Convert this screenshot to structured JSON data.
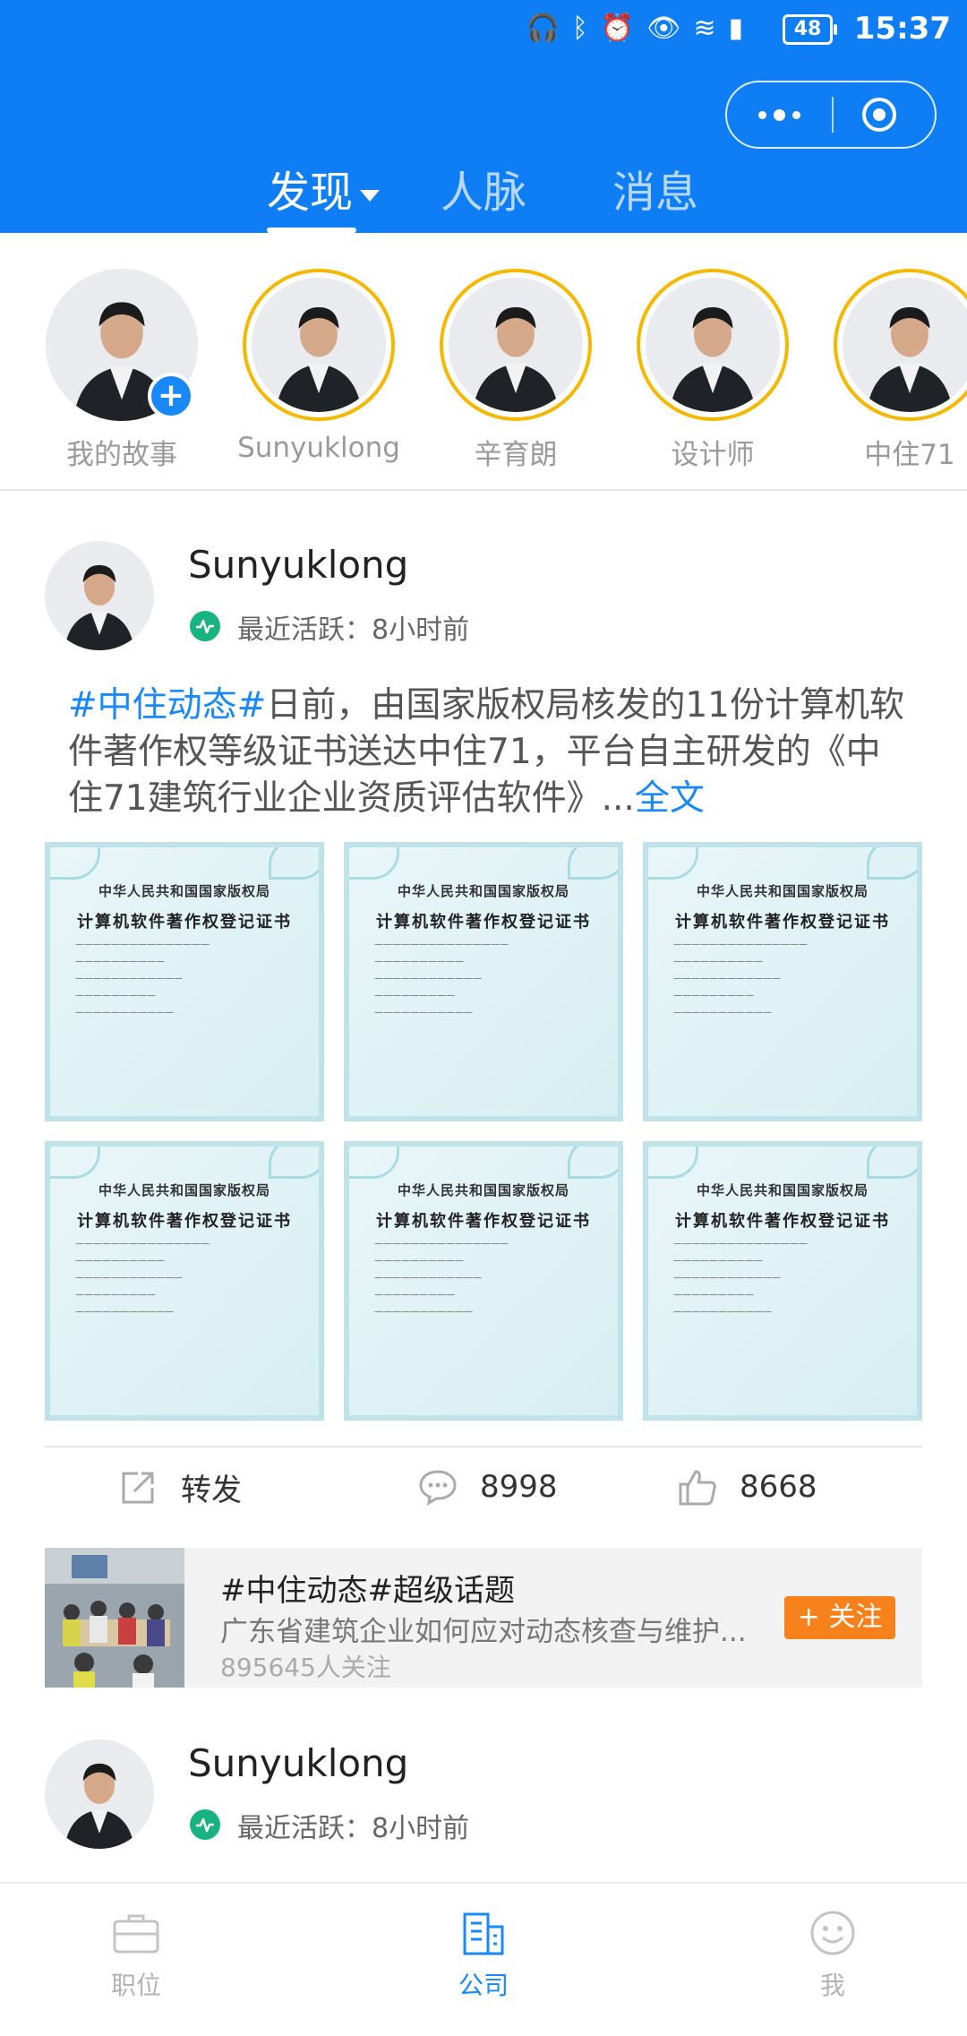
{
  "status_bar": {
    "battery": "48",
    "time": "15:37"
  },
  "top_tabs": [
    {
      "label": "发现",
      "active": true
    },
    {
      "label": "人脉",
      "active": false
    },
    {
      "label": "消息",
      "active": false
    }
  ],
  "stories": [
    {
      "name": "我的故事"
    },
    {
      "name": "Sunyuklong"
    },
    {
      "name": "辛育朗"
    },
    {
      "name": "设计师"
    },
    {
      "name": "中住71"
    }
  ],
  "post1": {
    "author": "Sunyuklong",
    "activity": "最近活跃：8小时前",
    "tag": "#中住动态#",
    "text": "日前，由国家版权局核发的11份计算机软件著作权等级证书送达中住71，平台自主研发的《中住71建筑行业企业资质评估软件》...",
    "more": "全文",
    "certificates": [
      {
        "org": "中华人民共和国国家版权局",
        "title": "计算机软件著作权登记证书"
      },
      {
        "org": "中华人民共和国国家版权局",
        "title": "计算机软件著作权登记证书"
      },
      {
        "org": "中华人民共和国国家版权局",
        "title": "计算机软件著作权登记证书"
      },
      {
        "org": "中华人民共和国国家版权局",
        "title": "计算机软件著作权登记证书"
      },
      {
        "org": "中华人民共和国国家版权局",
        "title": "计算机软件著作权登记证书"
      },
      {
        "org": "中华人民共和国国家版权局",
        "title": "计算机软件著作权登记证书"
      }
    ],
    "repost_label": "转发",
    "comments": "8998",
    "likes": "8668"
  },
  "topic": {
    "title": "#中住动态#超级话题",
    "desc": "广东省建筑企业如何应对动态核查与维护...",
    "followers": "895645人关注",
    "follow_label": "+ 关注"
  },
  "post2": {
    "author": "Sunyuklong",
    "activity": "最近活跃：8小时前"
  },
  "bottom_tabs": [
    {
      "label": "职位",
      "active": false
    },
    {
      "label": "公司",
      "active": true
    },
    {
      "label": "我",
      "active": false
    }
  ],
  "colors": {
    "header_blue": "#0f7ef5",
    "link_blue": "#1989fa",
    "story_ring": "#f5b800",
    "follow_orange": "#f7821b",
    "active_green": "#19b37f"
  }
}
